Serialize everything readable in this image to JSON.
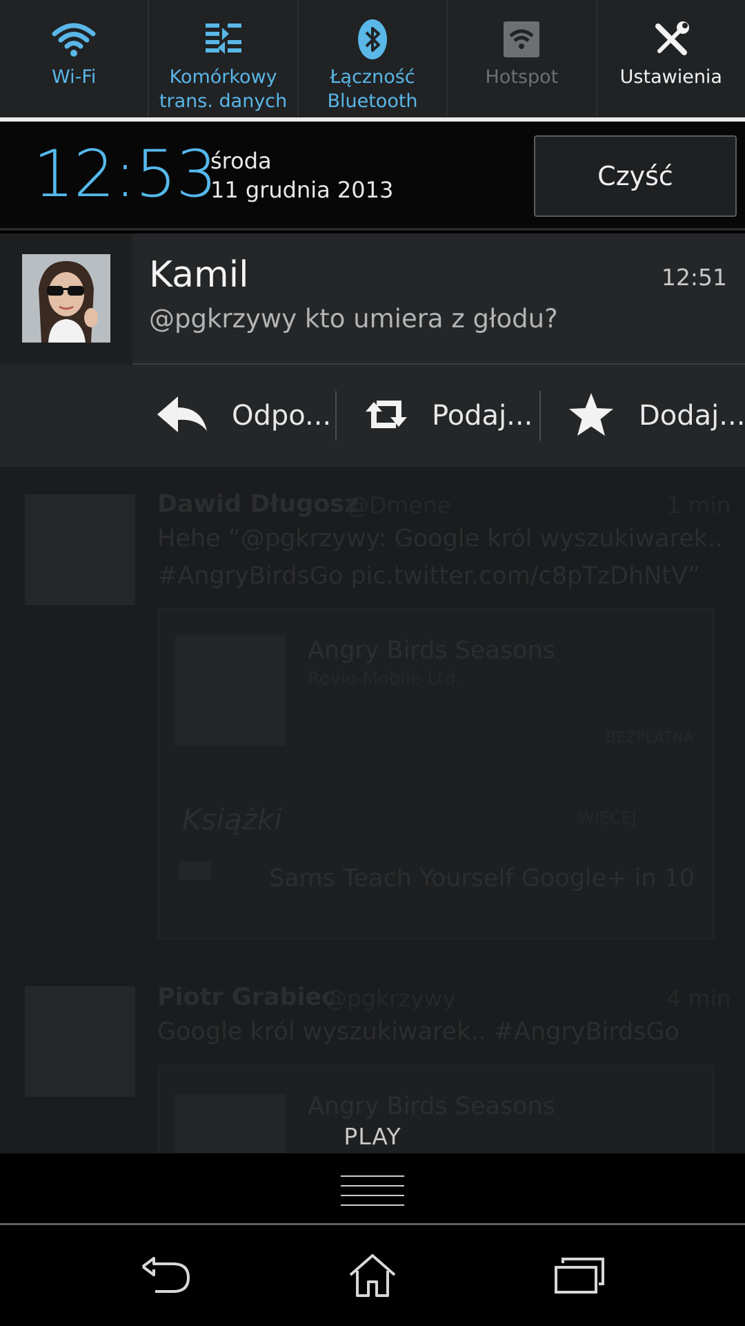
{
  "quick_settings": [
    {
      "label": "Wi-Fi",
      "icon": "wifi-icon",
      "state": "on"
    },
    {
      "label": "Komórkowy\ntrans. danych",
      "icon": "mobile-data-icon",
      "state": "on"
    },
    {
      "label": "Łączność\nBluetooth",
      "icon": "bluetooth-icon",
      "state": "on"
    },
    {
      "label": "Hotspot",
      "icon": "hotspot-icon",
      "state": "off"
    },
    {
      "label": "Ustawienia",
      "icon": "settings-tools-icon",
      "state": "neutral"
    }
  ],
  "header": {
    "time": "12:53",
    "day": "środa",
    "date": "11 grudnia 2013",
    "clear_label": "Czyść"
  },
  "notification": {
    "title": "Kamil",
    "time": "12:51",
    "text": "@pgkrzywy kto umiera z głodu?",
    "actions": [
      {
        "label": "Odpo...",
        "icon": "reply-icon"
      },
      {
        "label": "Podaj...",
        "icon": "retweet-icon"
      },
      {
        "label": "Dodaj...",
        "icon": "star-icon"
      }
    ]
  },
  "background_feed": {
    "tweet1_name": "Dawid Długosz",
    "tweet1_handle": "@Dmene",
    "tweet1_time": "1 min",
    "tweet1_line1": "Hehe “@pgkrzywy: Google król wyszukiwarek..",
    "tweet1_line2": "#AngryBirdsGo pic.twitter.com/c8pTzDhNtV”",
    "card_app_title": "Angry Birds Seasons",
    "card_app_dev": "Rovio Mobile Ltd.",
    "card_app_price": "BEZPŁATNA",
    "books_header": "Książki",
    "books_more": "WIĘCEJ",
    "book_title": "Sams Teach Yourself Google+ in 10",
    "tweet2_name": "Piotr Grabiec",
    "tweet2_handle": "@pgkrzywy",
    "tweet2_time": "4 min",
    "tweet2_line1": "Google król wyszukiwarek.. #AngryBirdsGo",
    "card2_title": "Angry Birds Seasons"
  },
  "panel": {
    "tab_label": "PLAY"
  },
  "navbar": {
    "back_icon": "back-icon",
    "home_icon": "home-icon",
    "recents_icon": "recents-icon"
  },
  "colors": {
    "accent": "#56b8ec",
    "off": "#6d6f70"
  }
}
